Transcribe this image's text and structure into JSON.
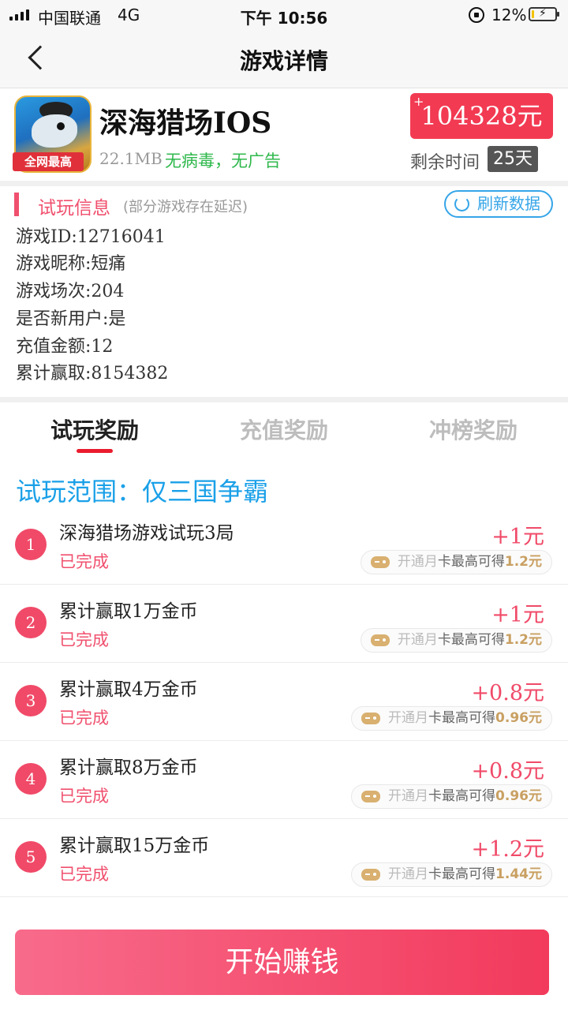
{
  "status_bar": {
    "carrier": "中国联通",
    "network": "4G",
    "time": "下午 10:56",
    "battery": "12%",
    "battery_level": 0.12
  },
  "nav": {
    "title": "游戏详情"
  },
  "game": {
    "name": "深海猎场IOS",
    "badge": "全网最高",
    "size": "22.1MB",
    "tags": "无病毒，无广告",
    "price_prefix": "+",
    "price": "104328元",
    "remaining_label": "剩余时间",
    "remaining_days": "25天"
  },
  "trial_info": {
    "title": "试玩信息",
    "note": "(部分游戏存在延迟)",
    "refresh_label": "刷新数据",
    "lines": [
      "游戏ID:12716041",
      "游戏昵称:短痛",
      "游戏场次:204",
      "是否新用户:是",
      "充值金额:12",
      "累计赢取:8154382"
    ]
  },
  "tabs": [
    {
      "label": "试玩奖励"
    },
    {
      "label": "充值奖励"
    },
    {
      "label": "冲榜奖励"
    }
  ],
  "scope": "试玩范围：仅三国争霸",
  "tasks": [
    {
      "num": "1",
      "name": "深海猎场游戏试玩3局",
      "status": "已完成",
      "reward": "+1元",
      "bonus_pre": "开通月",
      "bonus_card": "卡最高可得",
      "bonus_amount": "1.2元"
    },
    {
      "num": "2",
      "name": "累计赢取1万金币",
      "status": "已完成",
      "reward": "+1元",
      "bonus_pre": "开通月",
      "bonus_card": "卡最高可得",
      "bonus_amount": "1.2元"
    },
    {
      "num": "3",
      "name": "累计赢取4万金币",
      "status": "已完成",
      "reward": "+0.8元",
      "bonus_pre": "开通月",
      "bonus_card": "卡最高可得",
      "bonus_amount": "0.96元"
    },
    {
      "num": "4",
      "name": "累计赢取8万金币",
      "status": "已完成",
      "reward": "+0.8元",
      "bonus_pre": "开通月",
      "bonus_card": "卡最高可得",
      "bonus_amount": "0.96元"
    },
    {
      "num": "5",
      "name": "累计赢取15万金币",
      "status": "已完成",
      "reward": "+1.2元",
      "bonus_pre": "开通月",
      "bonus_card": "卡最高可得",
      "bonus_amount": "1.44元"
    }
  ],
  "cta": {
    "label": "开始赚钱"
  },
  "colors": {
    "accent": "#f23a52",
    "link_blue": "#1aa0e8",
    "success_green": "#2fb84c",
    "tab_indicator": "#ea1c2e"
  }
}
